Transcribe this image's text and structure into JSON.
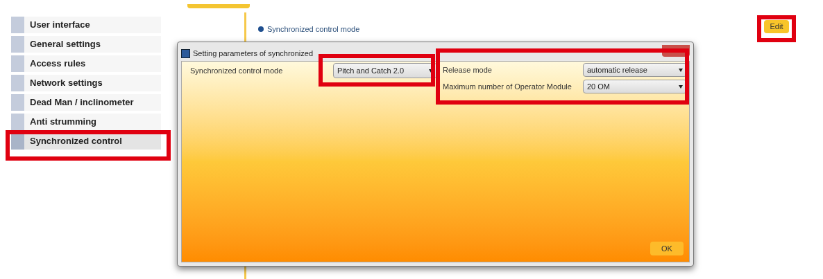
{
  "sidebar": {
    "items": [
      {
        "label": "User interface",
        "selected": false
      },
      {
        "label": "General settings",
        "selected": false
      },
      {
        "label": "Access rules",
        "selected": false
      },
      {
        "label": "Network settings",
        "selected": false
      },
      {
        "label": "Dead Man / inclinometer",
        "selected": false
      },
      {
        "label": "Anti strumming",
        "selected": false
      },
      {
        "label": "Synchronized control",
        "selected": true
      }
    ]
  },
  "section": {
    "title": "Synchronized control mode"
  },
  "edit_button": "Edit",
  "dialog": {
    "title": "Setting parameters of synchronized",
    "mode_label": "Synchronized control mode",
    "mode_value": "Pitch and Catch 2.0",
    "fields": [
      {
        "label": "Release mode",
        "value": "automatic release"
      },
      {
        "label": "Maximum number of Operator Module",
        "value": "20 OM"
      }
    ],
    "ok_button": "OK"
  }
}
